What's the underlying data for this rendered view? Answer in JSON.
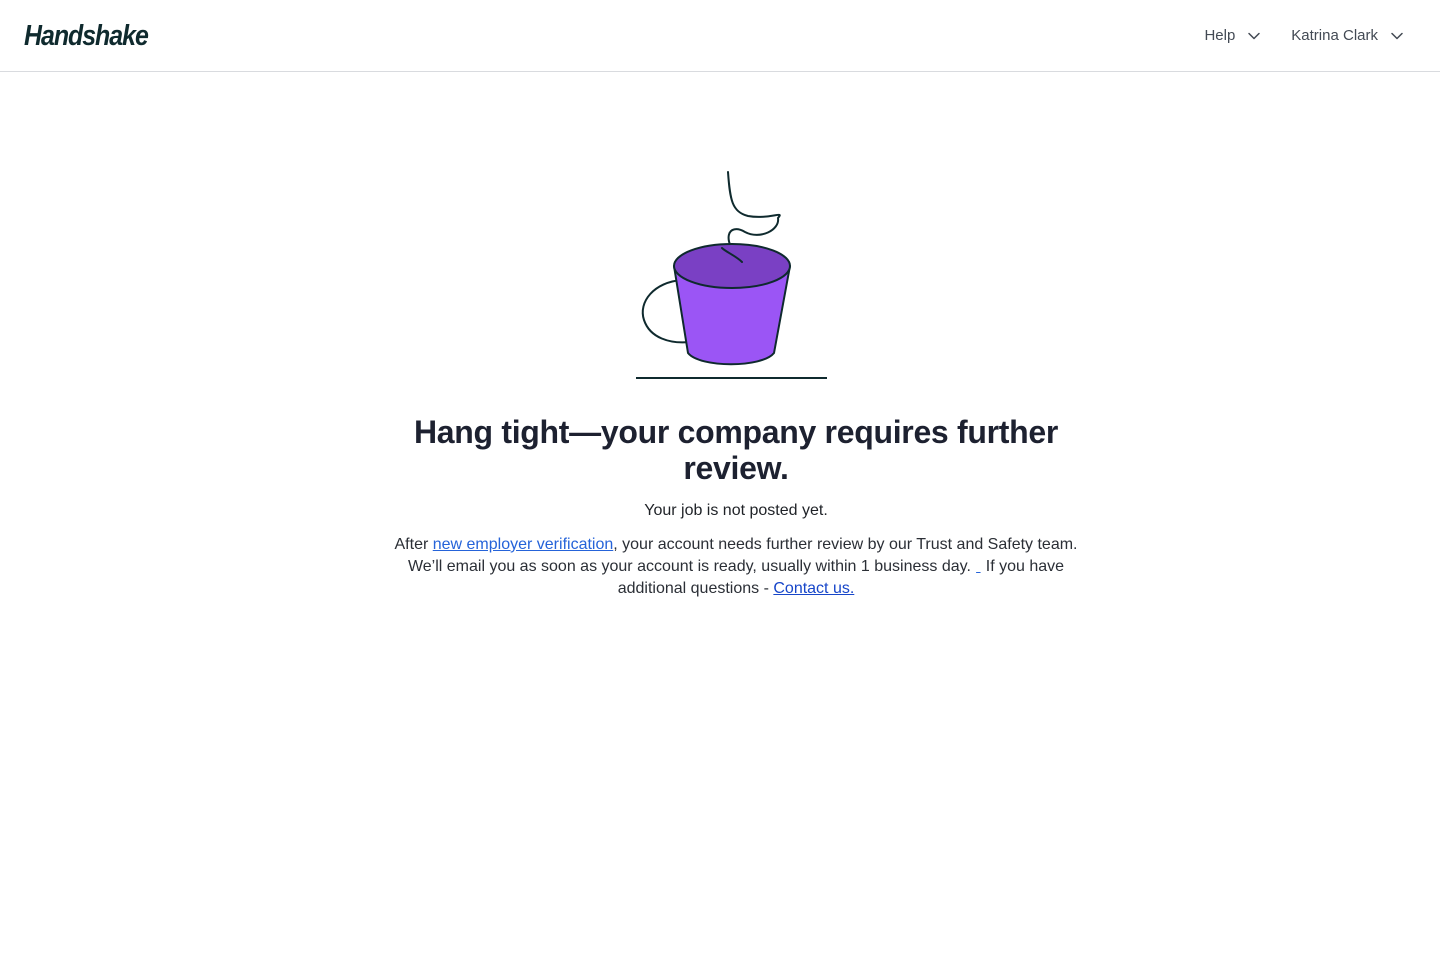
{
  "header": {
    "logo_text": "Handshake",
    "help_label": "Help",
    "user_name": "Katrina Clark"
  },
  "illustration": {
    "icon": "coffee-cup-illustration",
    "cup_color": "#9b55f5",
    "cup_top_color": "#7a40c4",
    "line_color": "#0f2a2e"
  },
  "main": {
    "headline": "Hang tight—your company requires further review.",
    "subhead": "Your job is not posted yet.",
    "body_before_link": "After ",
    "verification_link": "new employer verification",
    "body_middle": ", your account needs further review by our Trust and Safety team. We’ll email you as soon as your account is ready, usually within 1 business day.",
    "body_after_mark": " If you have additional questions - ",
    "contact_link": "Contact us."
  },
  "colors": {
    "link": "#2563d9",
    "contact_link": "#1746c9",
    "heading": "#1d2130",
    "divider": "#d9dbdf"
  }
}
